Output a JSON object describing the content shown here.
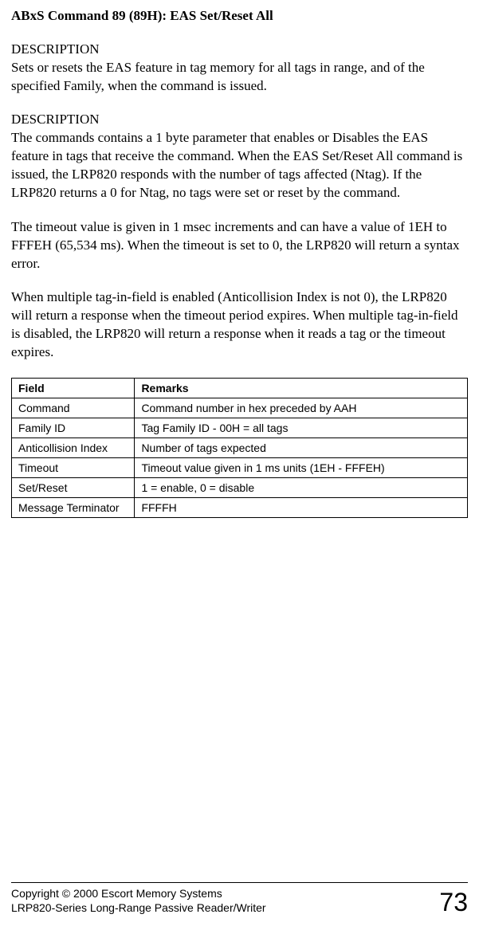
{
  "title": "ABxS Command 89 (89H): EAS Set/Reset All",
  "sections": [
    {
      "heading": "DESCRIPTION",
      "text": "Sets or resets the EAS feature in tag memory for all tags in range, and of the specified Family, when the command is issued."
    },
    {
      "heading": "DESCRIPTION",
      "text": "The commands contains a 1 byte parameter that enables or Disables the EAS feature in tags that receive the command. When the EAS Set/Reset All command is issued, the LRP820 responds with the number of tags affected (Ntag). If the LRP820 returns a 0 for Ntag, no tags were set or reset by the command."
    }
  ],
  "extra_paragraphs": [
    "The timeout value is given in 1 msec increments  and can have a value of 1EH to FFFEH (65,534 ms). When the timeout is set to 0, the LRP820 will return a syntax error.",
    "When multiple tag-in-field is enabled (Anticollision Index is not 0), the LRP820 will return a response when the timeout period expires. When multiple tag-in-field is disabled, the LRP820 will return a response when it reads a tag or the timeout expires."
  ],
  "table": {
    "headers": [
      "Field",
      "Remarks"
    ],
    "rows": [
      [
        "Command",
        "Command number in hex preceded by AAH"
      ],
      [
        "Family ID",
        "Tag Family ID - 00H = all tags"
      ],
      [
        "Anticollision Index",
        "Number of tags expected"
      ],
      [
        "Timeout",
        "Timeout value given in 1 ms units (1EH - FFFEH)"
      ],
      [
        "Set/Reset",
        "1 = enable, 0 = disable"
      ],
      [
        "Message Terminator",
        "FFFFH"
      ]
    ]
  },
  "footer": {
    "line1": "Copyright © 2000 Escort Memory Systems",
    "line2": "LRP820-Series Long-Range Passive Reader/Writer",
    "page_number": "73"
  }
}
